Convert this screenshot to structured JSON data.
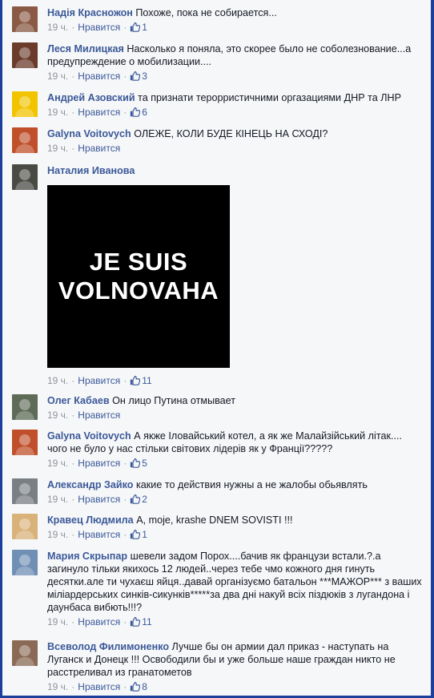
{
  "comments": [
    {
      "author": "Надія Красножон",
      "text": "Похоже, пока не собирается...",
      "time": "19 ч.",
      "like_label": "Нравится",
      "likes": "1",
      "avatar_icon": "user-avatar-icon",
      "avatar_color": "#8a5a44"
    },
    {
      "author": "Леся Милицкая",
      "text": "Насколько я поняла, это скорее было не соболезнование...а предупреждение о мобилизации....",
      "time": "19 ч.",
      "like_label": "Нравится",
      "likes": "3",
      "avatar_icon": "user-avatar-icon",
      "avatar_color": "#6b3b2b"
    },
    {
      "author": "Андрей Азовский",
      "text": "та признати терорристичними оргазациями ДНР та ЛНР",
      "time": "19 ч.",
      "like_label": "Нравится",
      "likes": "6",
      "avatar_icon": "user-avatar-icon",
      "avatar_color": "#f2c400"
    },
    {
      "author": "Galyna Voitovych",
      "text": "ОЛЕЖЕ, КОЛИ БУДЕ КІНЕЦЬ НА СХОДІ?",
      "time": "19 ч.",
      "like_label": "Нравится",
      "likes": "",
      "avatar_icon": "user-avatar-icon",
      "avatar_color": "#c0502c"
    },
    {
      "author": "Наталия Иванова",
      "text": "",
      "image_lines": [
        "JE SUIS",
        "VOLNOVAHA"
      ],
      "time": "19 ч.",
      "like_label": "Нравится",
      "likes": "11",
      "avatar_icon": "user-avatar-icon",
      "avatar_color": "#4a4a44"
    },
    {
      "author": "Олег Кабаев",
      "text": "Он лицо Путина отмывает",
      "time": "19 ч.",
      "like_label": "Нравится",
      "likes": "",
      "avatar_icon": "user-avatar-icon",
      "avatar_color": "#5e6b57"
    },
    {
      "author": "Galyna Voitovych",
      "text": "А якже Іловайський котел, а як же Малайзійський літак.... чого не було у нас стільки світових лідерів як у Франції?????",
      "time": "19 ч.",
      "like_label": "Нравится",
      "likes": "5",
      "avatar_icon": "user-avatar-icon",
      "avatar_color": "#c0502c"
    },
    {
      "author": "Александр Зайко",
      "text": "какие то действия нужны а не жалобы обьявлять",
      "time": "19 ч.",
      "like_label": "Нравится",
      "likes": "2",
      "avatar_icon": "user-avatar-icon",
      "avatar_color": "#7a7f84"
    },
    {
      "author": "Кравец Людмила",
      "text": "А, moje, krashe DNEM SOVISTI !!!",
      "time": "19 ч.",
      "like_label": "Нравится",
      "likes": "1",
      "avatar_icon": "user-avatar-icon",
      "avatar_color": "#d9b27a"
    },
    {
      "author": "Мария Скрыпар",
      "text": "шевели задом Порох....бачив як французи встали.?.а загинуло тільки якихось 12 людей..через тебе чмо кожного дня гинуть десятки.але ти чухаєш яйця..давай організуємо батальон ***МАЖОР*** з ваших міліардерських синків-сикунків*****за два дні накуй всіх піздюків з лугандона і даунбаса вибють!!!?",
      "time": "19 ч.",
      "like_label": "Нравится",
      "likes": "11",
      "avatar_icon": "user-avatar-icon",
      "avatar_color": "#6f8fb5"
    },
    {
      "author": "Всеволод Филимоненко",
      "text": "Лучше бы он армии дал приказ - наступать на Луганск и Донецк !!! Освободили бы и уже больше наше граждан никто не расстреливал из гранатометов",
      "time": "19 ч.",
      "like_label": "Нравится",
      "likes": "8",
      "avatar_icon": "user-avatar-icon",
      "avatar_color": "#8a6a56"
    }
  ]
}
